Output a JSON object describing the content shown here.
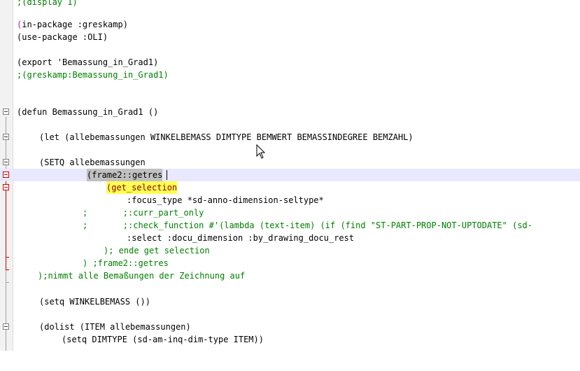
{
  "editor": {
    "lines": {
      "display": ";(display 1)",
      "in_package": "(in-package :greskamp)",
      "use_package": "(use-package :OLI)",
      "export": "(export 'Bemassung_in_Grad1)",
      "comment_call": ";(greskamp:Bemassung_in_Grad1)",
      "defun": "(defun Bemassung_in_Grad1 ()",
      "let": "(let (allebemassungen WINKELBEMASS DIMTYPE BEMWERT BEMASSINDEGREE BEMZAHL)",
      "setq_alle": "(SETQ allebemassungen",
      "frame2": "(frame2::getres",
      "get_selection": "(get_selection",
      "focus_type": ":focus_type *sd-anno-dimension-seltype*",
      "curr_part": ";       ;:curr_part_only",
      "check_function": ";       ;:check_function #'(lambda (text-item) (if (find \"ST-PART-PROP-NOT-UPTODATE\" (sd-",
      "select": ":select :docu_dimension :by_drawing_docu_rest",
      "ende_get": "); ende get selection",
      "frame2_close": ") ;frame2::getres",
      "nimmt": ");nimmt alle Bemaßungen der Zeichnung auf",
      "setq_winkel": "(setq WINKELBEMASS ())",
      "dolist": "(dolist (ITEM allebemassungen)",
      "setq_dimtype": "(setq DIMTYPE (sd-am-inq-dim-type ITEM))"
    }
  }
}
